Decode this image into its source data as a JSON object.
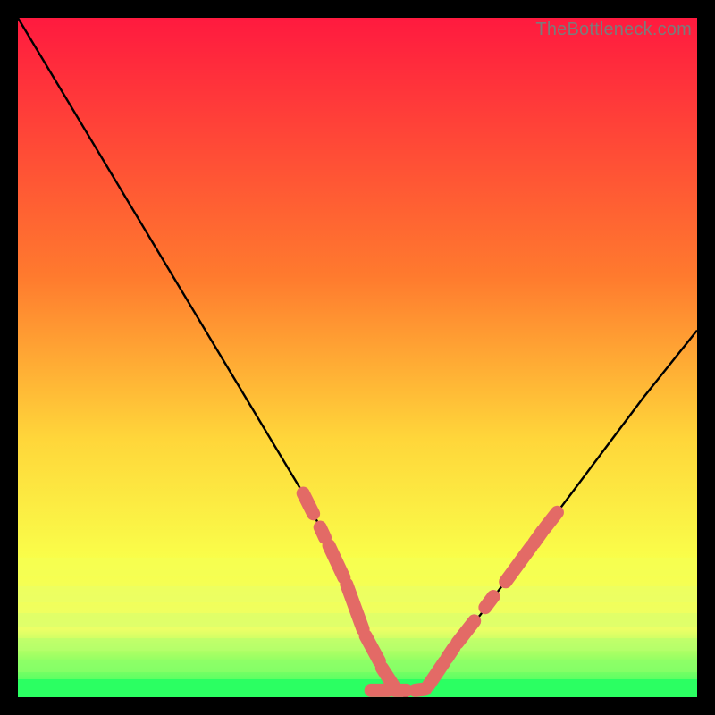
{
  "watermark": "TheBottleneck.com",
  "colors": {
    "bg": "#000000",
    "gradient_top": "#ff1a3f",
    "gradient_mid1": "#ff7a2e",
    "gradient_mid2": "#ffd63a",
    "gradient_low": "#f9ff4a",
    "gradient_band": "#ecff66",
    "gradient_bottom": "#2bff62",
    "curve": "#000000",
    "capsule_fill": "#e36a66",
    "capsule_stroke": "#d85a55"
  },
  "chart_data": {
    "type": "line",
    "title": "",
    "xlabel": "",
    "ylabel": "",
    "xlim": [
      0,
      100
    ],
    "ylim": [
      0,
      100
    ],
    "grid": false,
    "legend": false,
    "series": [
      {
        "name": "bottleneck-curve",
        "x": [
          0,
          6,
          12,
          18,
          24,
          30,
          36,
          42,
          47,
          50,
          53,
          55,
          57,
          60,
          63,
          68,
          74,
          80,
          86,
          92,
          100
        ],
        "y": [
          100,
          90,
          80,
          70,
          60,
          50,
          40,
          30,
          20,
          12,
          6,
          2,
          0,
          2,
          6,
          12,
          20,
          28,
          36,
          44,
          54
        ]
      }
    ],
    "annotations": {
      "left_capsules": [
        {
          "x1": 42.0,
          "y1": 30.0,
          "x2": 43.5,
          "y2": 27.0
        },
        {
          "x1": 44.5,
          "y1": 25.0,
          "x2": 45.2,
          "y2": 23.5
        },
        {
          "x1": 45.8,
          "y1": 22.3,
          "x2": 48.0,
          "y2": 17.6
        },
        {
          "x1": 48.4,
          "y1": 16.6,
          "x2": 50.8,
          "y2": 10.0
        },
        {
          "x1": 51.2,
          "y1": 9.0,
          "x2": 53.2,
          "y2": 5.3
        },
        {
          "x1": 53.6,
          "y1": 4.3,
          "x2": 55.6,
          "y2": 1.2
        }
      ],
      "bottom_capsules": [
        {
          "x1": 52.0,
          "y1": 1.0,
          "x2": 54.5,
          "y2": 1.0
        },
        {
          "x1": 55.5,
          "y1": 1.0,
          "x2": 57.2,
          "y2": 1.0
        },
        {
          "x1": 58.5,
          "y1": 1.0,
          "x2": 60.0,
          "y2": 1.2
        }
      ],
      "right_capsules": [
        {
          "x1": 60.5,
          "y1": 1.8,
          "x2": 62.8,
          "y2": 5.2
        },
        {
          "x1": 63.2,
          "y1": 5.8,
          "x2": 64.2,
          "y2": 7.3
        },
        {
          "x1": 64.7,
          "y1": 8.0,
          "x2": 67.2,
          "y2": 11.2
        },
        {
          "x1": 68.8,
          "y1": 13.2,
          "x2": 70.0,
          "y2": 14.8
        },
        {
          "x1": 71.8,
          "y1": 17.0,
          "x2": 75.6,
          "y2": 22.2
        },
        {
          "x1": 76.0,
          "y1": 22.7,
          "x2": 77.2,
          "y2": 24.4
        },
        {
          "x1": 77.6,
          "y1": 24.9,
          "x2": 79.4,
          "y2": 27.2
        }
      ]
    }
  }
}
